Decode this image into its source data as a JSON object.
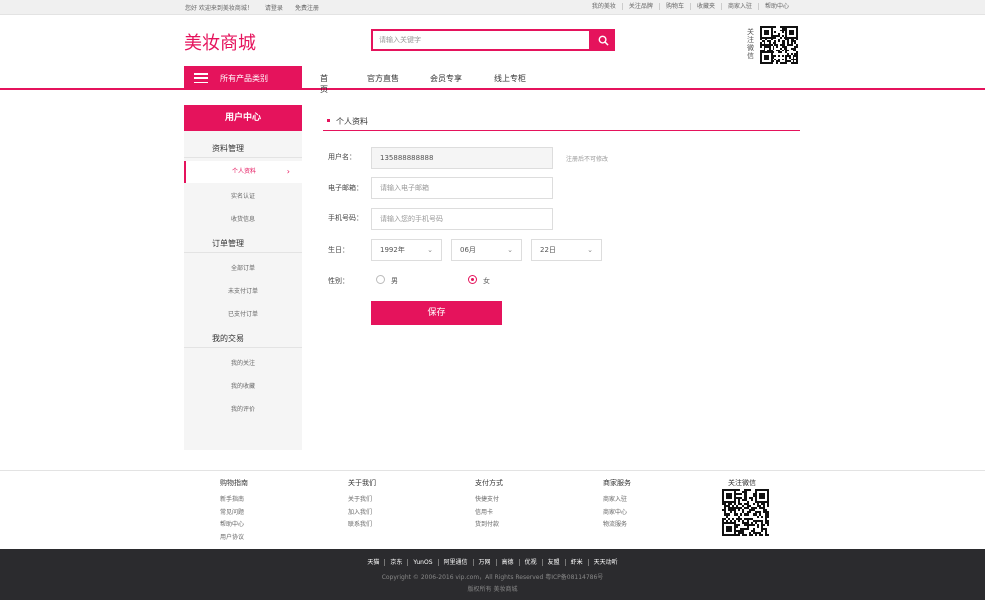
{
  "topbar": {
    "welcome": "您好 欢迎来到美妆商城！",
    "login": "请登录",
    "register": "免费注册",
    "links": [
      "我的美妆",
      "关注品牌",
      "购物车",
      "收藏夹",
      "商家入驻",
      "帮助中心"
    ]
  },
  "header": {
    "logo": "美妆商城",
    "search_placeholder": "请输入关键字",
    "qr_label": "关注微信"
  },
  "nav": {
    "category_button": "所有产品类别",
    "links": [
      "首页",
      "官方直售",
      "会员专享",
      "线上专柜"
    ]
  },
  "sidebar": {
    "title": "用户中心",
    "groups": [
      {
        "label": "资料管理",
        "items": [
          "个人资料",
          "实名认证",
          "收货信息"
        ]
      },
      {
        "label": "订单管理",
        "items": [
          "全部订单",
          "未支付订单",
          "已支付订单"
        ]
      },
      {
        "label": "我的交易",
        "items": [
          "我的关注",
          "我的收藏",
          "我的评价"
        ]
      }
    ]
  },
  "form": {
    "section_title": "个人资料",
    "username_label": "用户名：",
    "username_value": "135888888888",
    "username_hint": "注册后不可修改",
    "email_label": "电子邮箱：",
    "email_placeholder": "请输入电子邮箱",
    "phone_label": "手机号码：",
    "phone_placeholder": "请输入您的手机号码",
    "birthday_label": "生日：",
    "year": "1992年",
    "month": "06月",
    "day": "22日",
    "gender_label": "性别：",
    "gender_male": "男",
    "gender_female": "女",
    "gender_selected": "女",
    "save_button": "保存"
  },
  "footer": {
    "columns": [
      {
        "title": "购物指南",
        "links": [
          "新手指南",
          "常见问题",
          "帮助中心",
          "用户协议"
        ]
      },
      {
        "title": "关于我们",
        "links": [
          "关于我们",
          "加入我们",
          "联系我们"
        ]
      },
      {
        "title": "支付方式",
        "links": [
          "快捷支付",
          "信用卡",
          "货到付款"
        ]
      },
      {
        "title": "商家服务",
        "links": [
          "商家入驻",
          "商家中心",
          "物流服务"
        ]
      }
    ],
    "qr_title": "关注微信",
    "bottom_links": [
      "天猫",
      "京东",
      "YunOS",
      "阿里通信",
      "万网",
      "高德",
      "优视",
      "友盟",
      "虾米",
      "天天动听"
    ],
    "copyright": "Copyright © 2006-2016 vip.com，All Rights Reserved 粤ICP备08114786号",
    "rights": "版权所有  美妆商城"
  },
  "colors": {
    "accent": "#e5135c",
    "footer_bg": "#2b2b2e"
  }
}
